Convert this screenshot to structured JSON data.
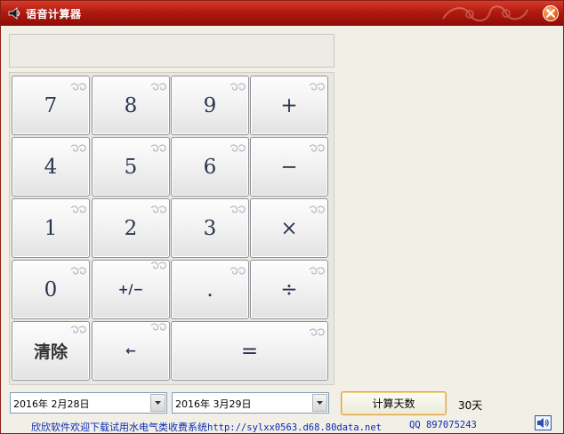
{
  "window": {
    "title": "语音计算器"
  },
  "display": {
    "value": ""
  },
  "keypad": {
    "rows": [
      [
        "7",
        "8",
        "9",
        "+"
      ],
      [
        "4",
        "5",
        "6",
        "−"
      ],
      [
        "1",
        "2",
        "3",
        "×"
      ],
      [
        "0",
        "+/−",
        ".",
        "÷"
      ]
    ],
    "clear_label": "清除",
    "backspace_label": "←",
    "equals_label": "="
  },
  "dates": {
    "start": "2016年  2月28日",
    "end": "2016年  3月29日"
  },
  "calc_days_button": "计算天数",
  "result": "30天",
  "footer": {
    "promo_text": "欣欣软件欢迎下载试用水电气类收费系统",
    "url": "http://sylxx0563.d68.80data.net",
    "qq": "QQ 897075243"
  },
  "colors": {
    "title_bar": "#b01a10",
    "key_text": "#2a3450",
    "link": "#0a2bb5"
  }
}
